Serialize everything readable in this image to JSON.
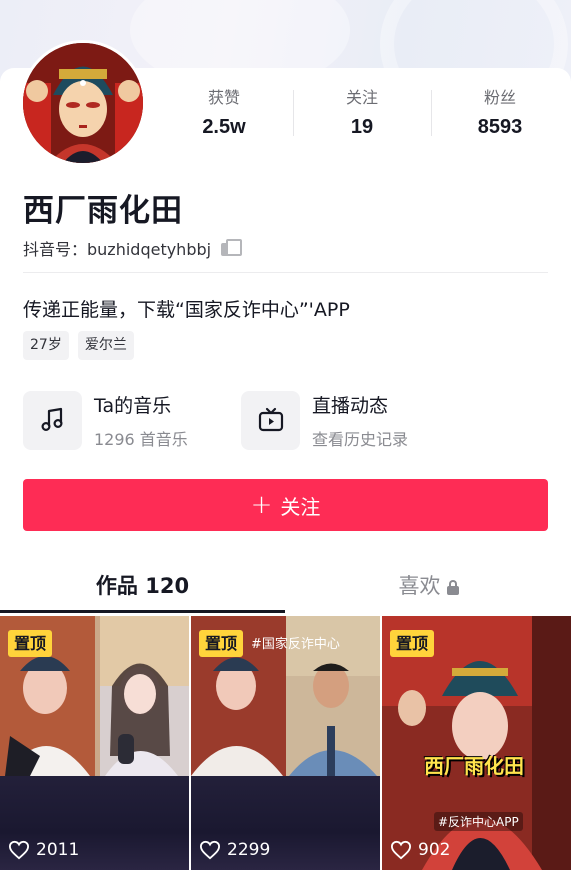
{
  "profile": {
    "name": "西厂雨化田",
    "douyin_id": "抖音号：buzhidqetyhbbj",
    "bio": "传递正能量，下载“国家反诈中心”'APP",
    "tags": [
      "27岁",
      "爱尔兰"
    ]
  },
  "stats": [
    {
      "label": "获赞",
      "value": "2.5w"
    },
    {
      "label": "关注",
      "value": "19"
    },
    {
      "label": "粉丝",
      "value": "8593"
    }
  ],
  "tiles": [
    {
      "icon": "music-note-icon",
      "title": "Ta的音乐",
      "subtitle": "1296 首音乐"
    },
    {
      "icon": "live-tv-icon",
      "title": "直播动态",
      "subtitle": "查看历史记录"
    }
  ],
  "follow_button": {
    "label": "关注"
  },
  "tabs": [
    {
      "label": "作品 120",
      "active": true
    },
    {
      "label": "喜欢",
      "active": false,
      "locked": true
    }
  ],
  "videos": [
    {
      "badge": "置顶",
      "likes": "2011"
    },
    {
      "badge": "置顶",
      "likes": "2299",
      "caption": "#国家反诈中心"
    },
    {
      "badge": "置顶",
      "likes": "902",
      "caption": "西厂雨化田",
      "sub_caption": "#反诈中心APP"
    }
  ],
  "colors": {
    "accent": "#fe2c55",
    "badge": "#ffd43b",
    "text": "#161823",
    "muted": "#8a8b91"
  }
}
